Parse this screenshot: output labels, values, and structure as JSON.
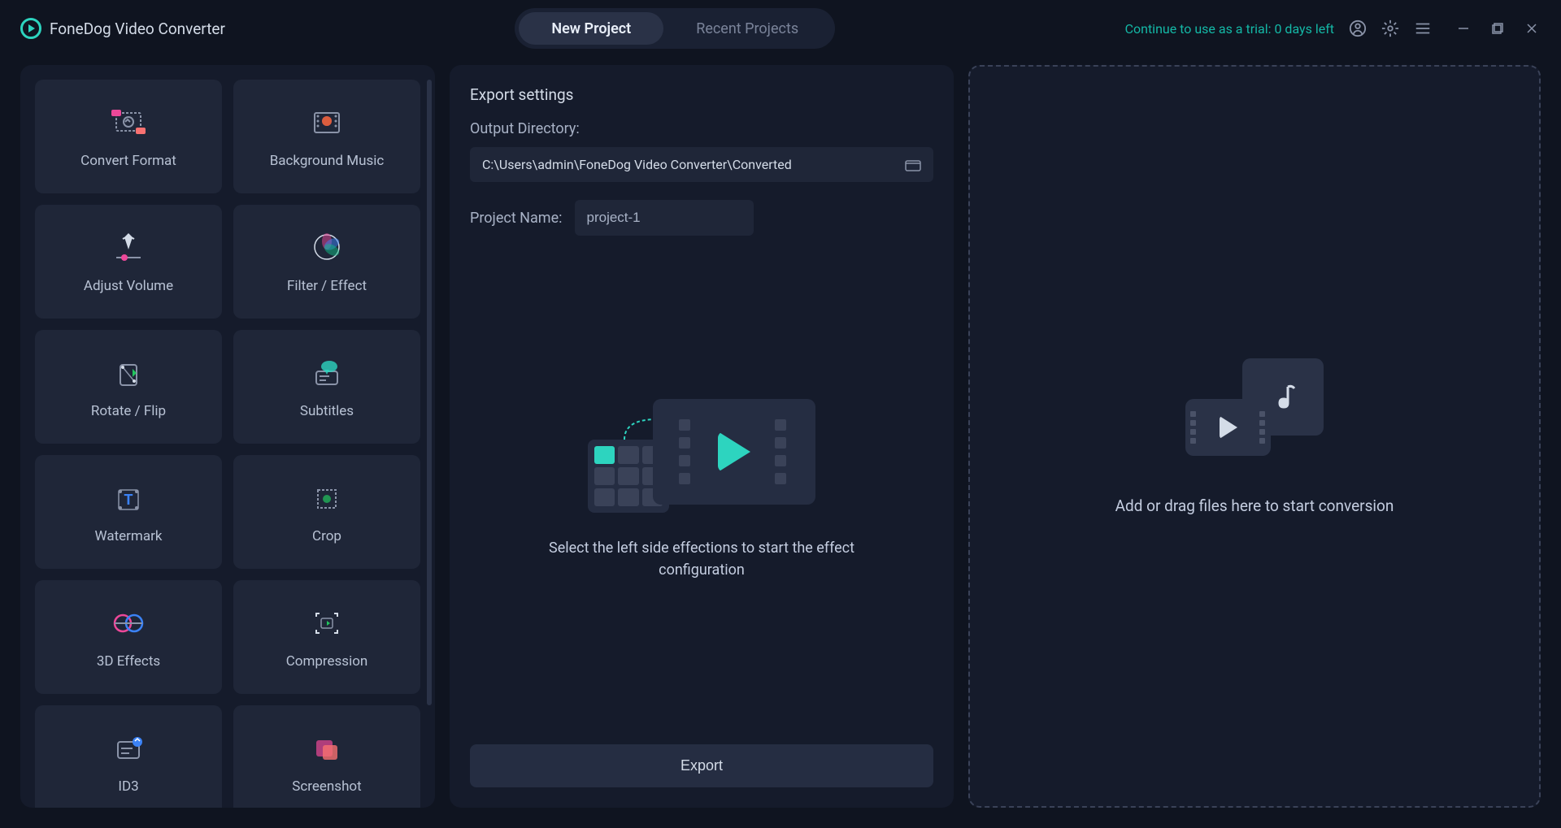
{
  "app": {
    "title": "FoneDog Video Converter"
  },
  "tabs": {
    "new_project": "New Project",
    "recent_projects": "Recent Projects"
  },
  "trial": {
    "text": "Continue to use as a trial: 0 days left"
  },
  "tools": [
    {
      "label": "Convert Format",
      "name": "convert-format"
    },
    {
      "label": "Background Music",
      "name": "background-music"
    },
    {
      "label": "Adjust Volume",
      "name": "adjust-volume"
    },
    {
      "label": "Filter / Effect",
      "name": "filter-effect"
    },
    {
      "label": "Rotate / Flip",
      "name": "rotate-flip"
    },
    {
      "label": "Subtitles",
      "name": "subtitles"
    },
    {
      "label": "Watermark",
      "name": "watermark"
    },
    {
      "label": "Crop",
      "name": "crop"
    },
    {
      "label": "3D Effects",
      "name": "3d-effects"
    },
    {
      "label": "Compression",
      "name": "compression"
    },
    {
      "label": "ID3",
      "name": "id3"
    },
    {
      "label": "Screenshot",
      "name": "screenshot"
    }
  ],
  "export": {
    "header": "Export settings",
    "output_label": "Output Directory:",
    "output_path": "C:\\Users\\admin\\FoneDog Video Converter\\Converted",
    "project_label": "Project Name:",
    "project_value": "project-1",
    "hint": "Select the left side effections to start the effect configuration",
    "button": "Export"
  },
  "drop": {
    "text": "Add or drag files here to start conversion"
  }
}
